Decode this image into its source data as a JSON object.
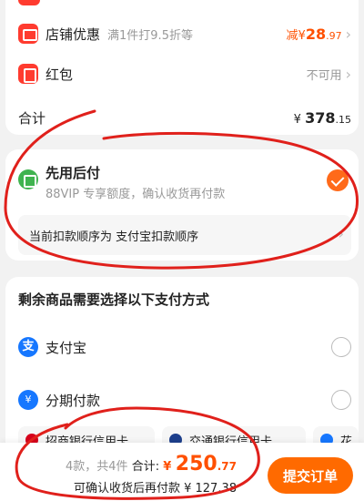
{
  "shop_discount": {
    "title": "店铺优惠",
    "subtitle": "满1件打9.5折等",
    "prefix": "减",
    "currency": "¥",
    "amount": "28",
    "decimal": ".97"
  },
  "hongbao": {
    "title": "红包",
    "status": "不可用"
  },
  "total": {
    "label": "合计",
    "currency": "¥",
    "amount": "378",
    "decimal": ".15"
  },
  "pay_later": {
    "title": "先用后付",
    "subtitle": "88VIP 专享额度，确认收货再付款",
    "checked": true,
    "order_text": "当前扣款顺序为 支付宝扣款顺序"
  },
  "remaining": {
    "title": "剩余商品需要选择以下支付方式",
    "options": [
      {
        "label": "支付宝",
        "icon": "alipay-icon"
      },
      {
        "label": "分期付款",
        "icon": "installment-icon"
      }
    ],
    "alipay_glyph": "支",
    "banks": [
      {
        "label": "招商银行信用卡",
        "color": "#d6001c"
      },
      {
        "label": "交通银行信用卡",
        "color": "#1d3f8c"
      },
      {
        "label": "花",
        "color": "#1677ff"
      }
    ]
  },
  "bottom": {
    "count_text": "4款，共4件",
    "total_label": "合计:",
    "currency": "¥",
    "amount": "250",
    "decimal": ".77",
    "after_text": "可确认收货后再付款 ¥ 127.38",
    "submit_label": "提交订单"
  },
  "colors": {
    "accent": "#ff5000",
    "submit": "#ff6a00",
    "annotation": "#e0201b"
  }
}
